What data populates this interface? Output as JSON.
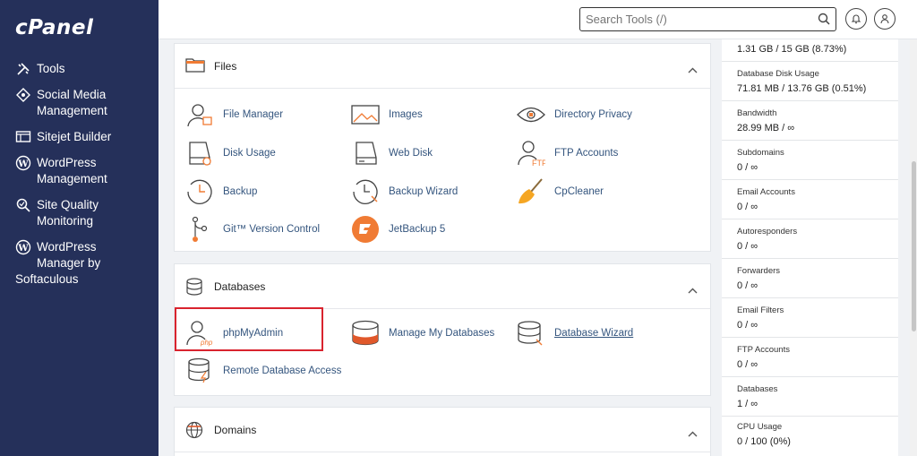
{
  "brand": {
    "logo": "cPanel"
  },
  "sidebar": {
    "items": [
      {
        "icon": "tools-icon",
        "label": "Tools"
      },
      {
        "icon": "social-media-icon",
        "label_line1": "Social Media",
        "label_line2": "Management"
      },
      {
        "icon": "sitejet-icon",
        "label": "Sitejet Builder"
      },
      {
        "icon": "wordpress-icon",
        "label_line1": "WordPress",
        "label_line2": "Management"
      },
      {
        "icon": "site-quality-icon",
        "label_line1": "Site Quality",
        "label_line2": "Monitoring"
      },
      {
        "icon": "wordpress-icon",
        "label_line1": "WordPress",
        "label_line2": "Manager by",
        "label_line3": "Softaculous"
      }
    ]
  },
  "header": {
    "search_placeholder": "Search Tools (/)"
  },
  "files": {
    "title": "Files",
    "tools": [
      {
        "label": "File Manager"
      },
      {
        "label": "Images"
      },
      {
        "label": "Directory Privacy"
      },
      {
        "label": "Disk Usage"
      },
      {
        "label": "Web Disk"
      },
      {
        "label": "FTP Accounts"
      },
      {
        "label": "Backup"
      },
      {
        "label": "Backup Wizard"
      },
      {
        "label": "CpCleaner"
      },
      {
        "label": "Git™ Version Control"
      },
      {
        "label": "JetBackup 5"
      }
    ]
  },
  "databases": {
    "title": "Databases",
    "tools": [
      {
        "label": "phpMyAdmin"
      },
      {
        "label": "Manage My Databases"
      },
      {
        "label": "Database Wizard"
      },
      {
        "label": "Remote Database Access"
      }
    ]
  },
  "domains": {
    "title": "Domains"
  },
  "stats": [
    {
      "label": "",
      "value": "1.31 GB / 15 GB   (8.73%)"
    },
    {
      "label": "Database Disk Usage",
      "value": "71.81 MB / 13.76 GB   (0.51%)"
    },
    {
      "label": "Bandwidth",
      "value": "28.99 MB / ∞"
    },
    {
      "label": "Subdomains",
      "value": "0 / ∞"
    },
    {
      "label": "Email Accounts",
      "value": "0 / ∞"
    },
    {
      "label": "Autoresponders",
      "value": "0 / ∞"
    },
    {
      "label": "Forwarders",
      "value": "0 / ∞"
    },
    {
      "label": "Email Filters",
      "value": "0 / ∞"
    },
    {
      "label": "FTP Accounts",
      "value": "0 / ∞"
    },
    {
      "label": "Databases",
      "value": "1 / ∞"
    },
    {
      "label": "CPU Usage",
      "value": "0 / 100   (0%)"
    }
  ],
  "colors": {
    "sidebar": "#25305a",
    "link": "#34557e",
    "accent_orange": "#f07b34",
    "highlight_red": "#d9232e"
  }
}
